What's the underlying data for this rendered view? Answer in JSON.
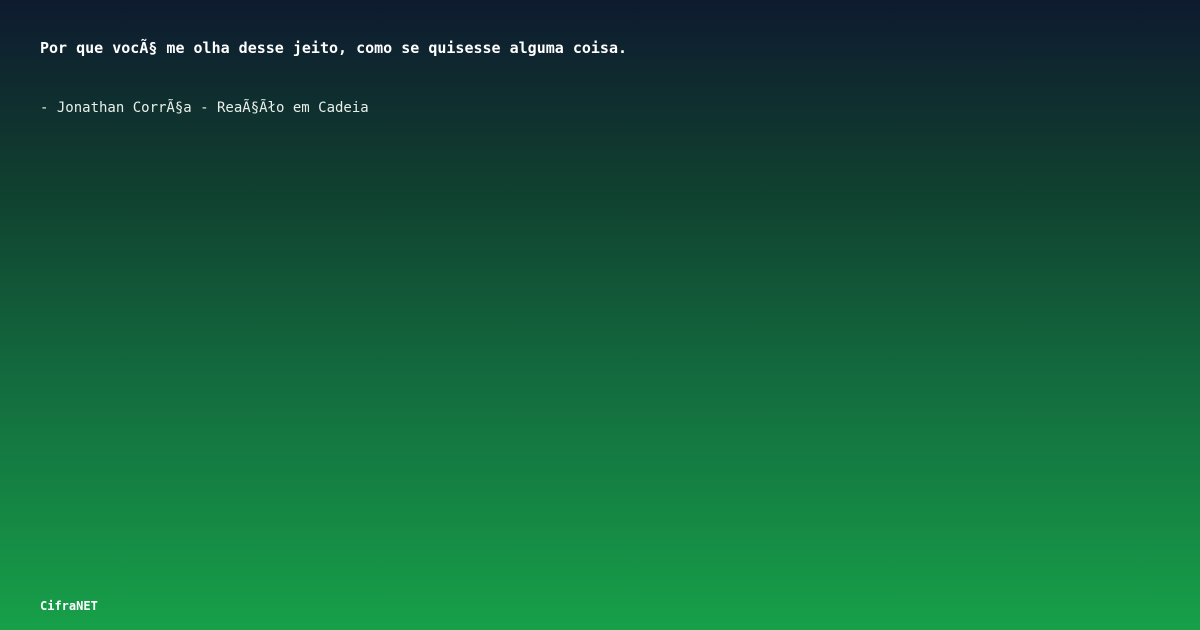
{
  "quote": {
    "text": "Por que vocÃ§ me olha desse jeito, como se quisesse alguma coisa."
  },
  "attribution": {
    "text": "- Jonathan CorrÃ§a - ReaÃ§Ãło em Cadeia"
  },
  "brand": {
    "name": "CifraNET"
  },
  "colors": {
    "gradient_top": "#0e1a2f",
    "gradient_bottom": "#17a049",
    "text": "#ffffff"
  }
}
